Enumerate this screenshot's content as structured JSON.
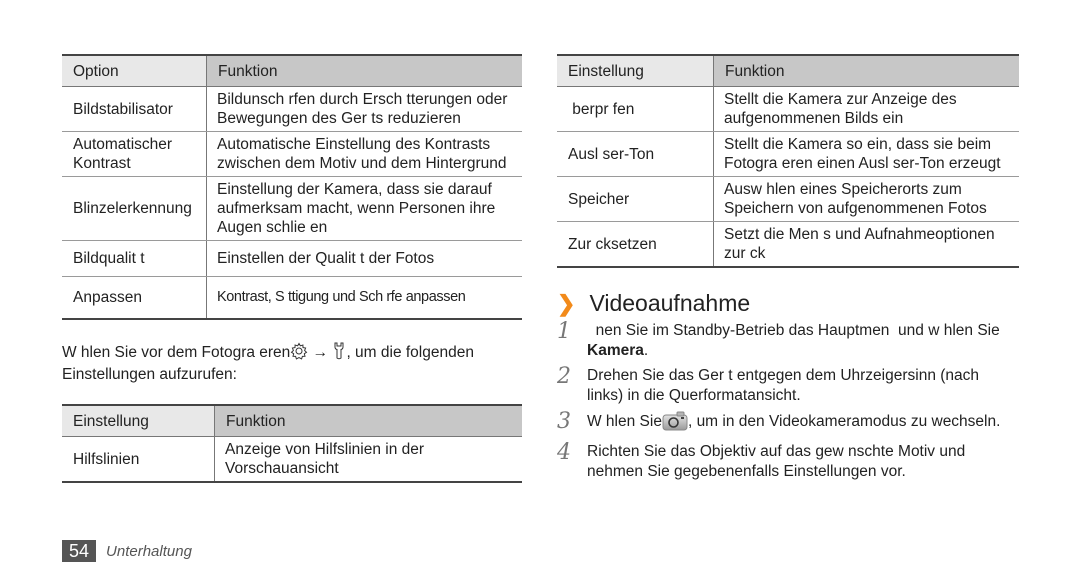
{
  "left": {
    "table1": {
      "headers": [
        "Option",
        "Funktion"
      ],
      "rows": [
        {
          "option": "Bildstabilisator",
          "function": "Bildunsch rfen durch Ersch tterungen oder Bewegungen des Ger ts reduzieren"
        },
        {
          "option": "Automatischer Kontrast",
          "function": "Automatische Einstellung des Kontrasts zwischen dem Motiv und dem Hintergrund"
        },
        {
          "option": "Blinzelerkennung",
          "function": "Einstellung der Kamera, dass sie darauf aufmerksam macht, wenn Personen ihre Augen schlie en"
        },
        {
          "option": "Bildqualit t",
          "function": "Einstellen der Qualit t der Fotos"
        },
        {
          "option": "Anpassen",
          "function": "Kontrast, S ttigung und Sch rfe anpassen"
        }
      ]
    },
    "paragraph": {
      "before": "W hlen Sie vor dem Fotogra eren",
      "arrow": "→",
      "after": ", um die folgenden Einstellungen aufzurufen:",
      "icons": [
        "settings-gear-icon",
        "wrench-icon"
      ]
    },
    "table2": {
      "headers": [
        "Einstellung",
        "Funktion"
      ],
      "rows": [
        {
          "option": "Hilfslinien",
          "function": "Anzeige von Hilfslinien in der Vorschauansicht"
        }
      ]
    }
  },
  "right": {
    "table": {
      "headers": [
        "Einstellung",
        "Funktion"
      ],
      "rows": [
        {
          "option": " berpr fen",
          "function": "Stellt die Kamera zur Anzeige des aufgenommenen Bilds ein"
        },
        {
          "option": "Ausl ser-Ton",
          "function": "Stellt die Kamera so ein, dass sie beim Fotogra eren einen Ausl ser-Ton erzeugt"
        },
        {
          "option": "Speicher",
          "function": "Ausw hlen eines Speicherorts zum Speichern von aufgenommenen Fotos"
        },
        {
          "option": "Zur cksetzen",
          "function": "Setzt die Men s und Aufnahmeoptionen zur ck"
        }
      ]
    },
    "section": {
      "chevron": "❯",
      "title": "Videoaufnahme",
      "accent_color": "#f28a1a"
    },
    "steps": [
      {
        "num": "1",
        "text": "  nen Sie im Standby-Betrieb das Hauptmen  und w hlen Sie ",
        "bold": "Kamera",
        "tail": "."
      },
      {
        "num": "2",
        "text": "Drehen Sie das Ger t entgegen dem Uhrzeigersinn (nach links) in die Querformatansicht."
      },
      {
        "num": "3",
        "text_before": "W hlen Sie",
        "icon": "camera-mode-icon",
        "text_after": ", um in den Videokameramodus zu wechseln."
      },
      {
        "num": "4",
        "text": "Richten Sie das Objektiv auf das gew nschte Motiv und nehmen Sie gegebenenfalls Einstellungen vor."
      }
    ]
  },
  "footer": {
    "page_number": "54",
    "chapter": "Unterhaltung"
  }
}
